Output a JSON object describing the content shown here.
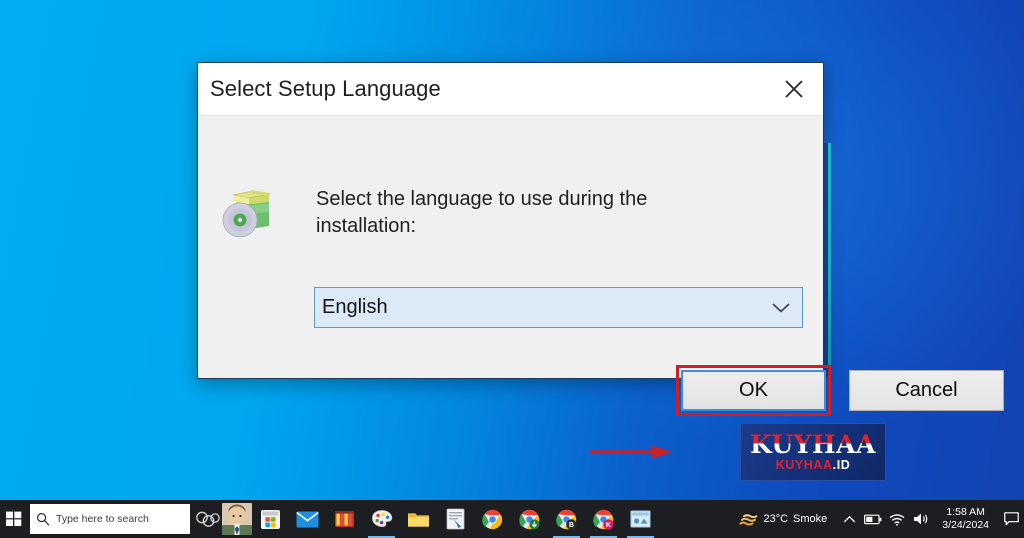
{
  "desktop": {
    "background_left_color": "#00ACF2",
    "background_right_color": "#1343B2"
  },
  "dialog": {
    "title": "Select Setup Language",
    "close_label": "✕",
    "icon_name": "inno-setup-package-icon",
    "prompt": "Select the language to use during the installation:",
    "language_select": {
      "value": "English",
      "options": [
        "English"
      ]
    },
    "buttons": {
      "ok": "OK",
      "cancel": "Cancel"
    }
  },
  "annotations": {
    "ok_highlight_color": "#C9202A",
    "arrow_color": "#C9202A",
    "focus_border_color": "#3E8EDE"
  },
  "watermark": {
    "main": "KUYHAA",
    "sub_red": "KUYHAA",
    "sub_white": ".ID",
    "main_color": "#E12229",
    "background_color": "#14307A"
  },
  "taskbar": {
    "start_label": "Start",
    "search": {
      "placeholder": "Type here to search"
    },
    "taskview_label": "Task View",
    "person_label": "Contact",
    "apps": [
      {
        "name": "microsoft-store-icon",
        "active": false
      },
      {
        "name": "mail-icon",
        "active": false
      },
      {
        "name": "winrar-icon",
        "active": false
      },
      {
        "name": "paint-icon",
        "active": true
      },
      {
        "name": "file-explorer-icon",
        "active": false
      },
      {
        "name": "document-editor-icon",
        "active": false
      },
      {
        "name": "chrome-icon",
        "active": false
      },
      {
        "name": "chrome-download-icon",
        "active": false
      },
      {
        "name": "chrome-browser-b-icon",
        "active": true
      },
      {
        "name": "chrome-browser-k-icon",
        "active": true
      },
      {
        "name": "media-player-icon",
        "active": true
      }
    ],
    "tray": {
      "weather_temp": "23°C",
      "weather_condition": "Smoke",
      "show_hidden_label": "Show hidden icons",
      "battery_label": "Battery",
      "network_label": "Network",
      "volume_label": "Volume",
      "time": "1:58 AM",
      "date": "3/24/2024",
      "notifications_label": "Notifications"
    }
  }
}
